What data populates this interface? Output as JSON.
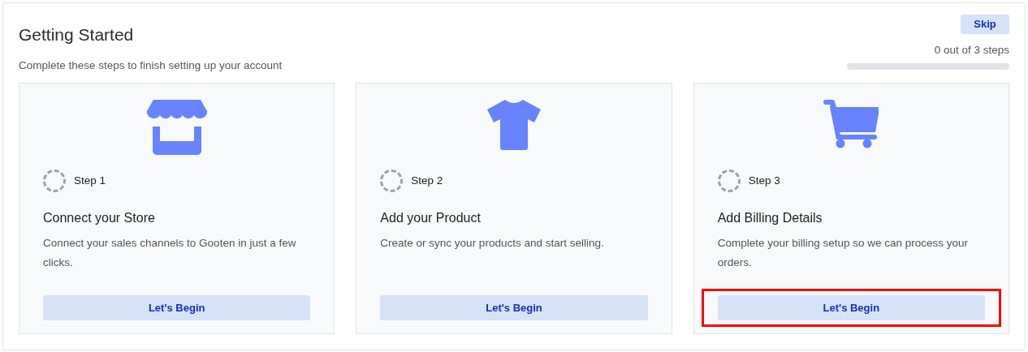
{
  "header": {
    "title": "Getting Started",
    "subtitle": "Complete these steps to finish setting up your account"
  },
  "skip_button": "Skip",
  "progress": {
    "label": "0 out of 3 steps",
    "level": 0
  },
  "steps": [
    {
      "step": "Step 1",
      "completed": false,
      "title": "Connect your Store",
      "description": "Connect your sales channels to Gooten in just a few clicks.",
      "button": "Let's Begin",
      "highlighted": false
    },
    {
      "step": "Step 2",
      "completed": false,
      "title": "Add your Product",
      "description": "Create or sync your products and start selling.",
      "button": "Let's Begin",
      "highlighted": false
    },
    {
      "step": "Step 3",
      "completed": false,
      "title": "Add Billing Details",
      "description": "Complete your billing setup so we can process your orders.",
      "button": "Let's Begin",
      "highlighted": true
    }
  ]
}
